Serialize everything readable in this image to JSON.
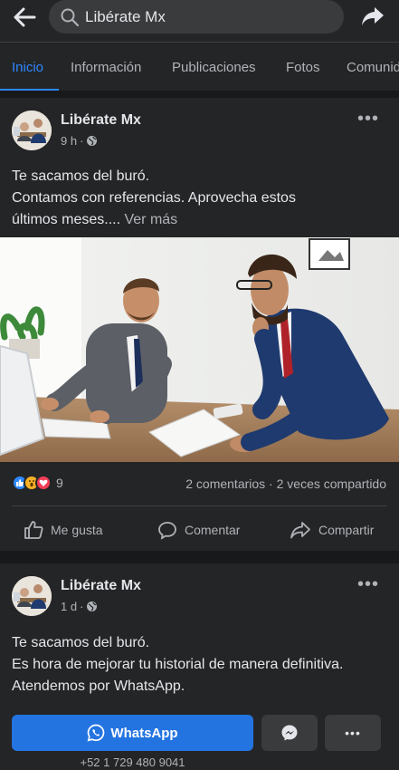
{
  "search": {
    "value": "Libérate Mx",
    "placeholder": "Buscar"
  },
  "tabs": [
    {
      "label": "Inicio",
      "active": true
    },
    {
      "label": "Información",
      "active": false
    },
    {
      "label": "Publicaciones",
      "active": false
    },
    {
      "label": "Fotos",
      "active": false
    },
    {
      "label": "Comunid",
      "active": false
    }
  ],
  "posts": [
    {
      "author": "Libérate Mx",
      "time": "9 h",
      "text_lines": [
        "Te sacamos del buró.",
        "Contamos con referencias. Aprovecha estos",
        "últimos meses...."
      ],
      "see_more": "Ver más",
      "reaction_count": "9",
      "engagement": "2 comentarios · 2 veces compartido",
      "actions": {
        "like": "Me gusta",
        "comment": "Comentar",
        "share": "Compartir"
      },
      "reaction_icons": [
        "like-icon",
        "wow-icon",
        "love-icon"
      ]
    },
    {
      "author": "Libérate Mx",
      "time": "1 d",
      "text_lines": [
        "Te sacamos del buró.",
        "Es hora de mejorar tu historial de manera definitiva.",
        "Atendemos por WhatsApp."
      ],
      "cta_label": "WhatsApp",
      "cta_phone": "+52 1 729 480 9041"
    }
  ],
  "colors": {
    "accent": "#2d88ff",
    "cta": "#2374e1",
    "surface": "#242526",
    "background": "#18191a",
    "text": "#e4e6eb",
    "secondary_text": "#b0b3b8"
  }
}
